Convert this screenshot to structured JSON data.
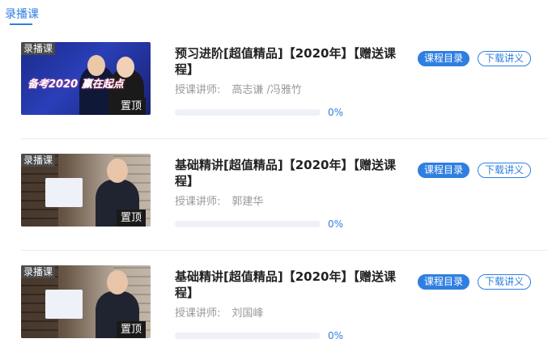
{
  "tab": {
    "label": "录播课"
  },
  "courses": [
    {
      "badge": "录播课",
      "pin": "置顶",
      "slogan": "备考2020 赢在起点",
      "title": "预习进阶[超值精品]【2020年】【赠送课程】",
      "teacher_label": "授课讲师:",
      "teacher_name": "高志谦 /冯雅竹",
      "progress": 0,
      "progress_text": "0%",
      "catalog_label": "课程目录",
      "download_label": "下载讲义"
    },
    {
      "badge": "录播课",
      "pin": "置顶",
      "title": "基础精讲[超值精品]【2020年】【赠送课程】",
      "teacher_label": "授课讲师:",
      "teacher_name": "郭建华",
      "progress": 0,
      "progress_text": "0%",
      "catalog_label": "课程目录",
      "download_label": "下载讲义"
    },
    {
      "badge": "录播课",
      "pin": "置顶",
      "title": "基础精讲[超值精品]【2020年】【赠送课程】",
      "teacher_label": "授课讲师:",
      "teacher_name": "刘国峰",
      "progress": 0,
      "progress_text": "0%",
      "catalog_label": "课程目录",
      "download_label": "下载讲义"
    }
  ],
  "colors": {
    "accent": "#2f7fe0",
    "badge_bg": "#4a4a4a",
    "muted_text": "#999999"
  }
}
